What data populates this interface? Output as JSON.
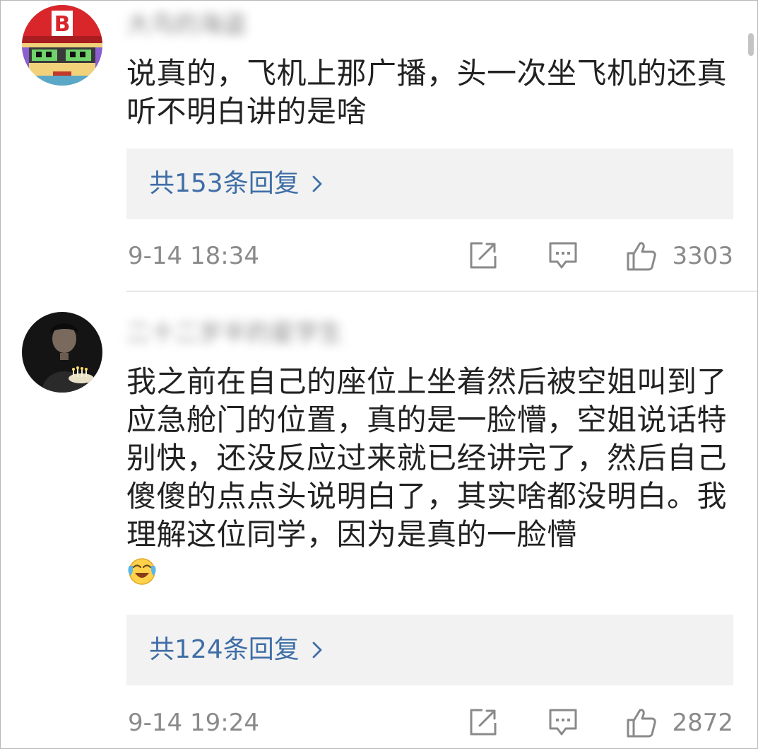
{
  "comments": [
    {
      "username": "大鸟的海盗",
      "text": "说真的，飞机上那广播，头一次坐飞机的还真听不明白讲的是啥",
      "replies_label": "共153条回复",
      "timestamp": "9-14 18:34",
      "likes": "3303",
      "avatar_letter": "B",
      "has_emoji": false
    },
    {
      "username": "二十二岁半的星学生",
      "text": "我之前在自己的座位上坐着然后被空姐叫到了应急舱门的位置，真的是一脸懵，空姐说话特别快，还没反应过来就已经讲完了，然后自己傻傻的点点头说明白了，其实啥都没明白。我理解这位同学，因为是真的一脸懵",
      "replies_label": "共124条回复",
      "timestamp": "9-14 19:24",
      "likes": "2872",
      "has_emoji": true,
      "emoji_icon": "laugh-cry-emoji"
    }
  ],
  "icons": {
    "forward": "forward-icon",
    "comment": "comment-icon",
    "like": "thumbs-up-icon",
    "chevron": "chevron-right-icon"
  },
  "colors": {
    "link": "#3f6ea6",
    "meta": "#8a8a8a",
    "reply_bg": "#f2f2f2"
  }
}
